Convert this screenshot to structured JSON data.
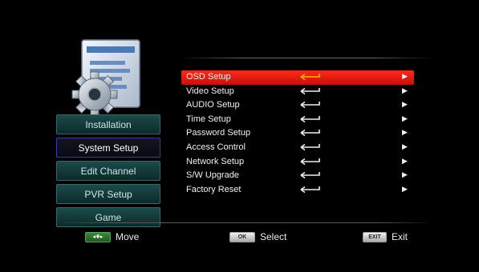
{
  "left_menu": {
    "items": [
      {
        "label": "Installation",
        "active": false
      },
      {
        "label": "System Setup",
        "active": true
      },
      {
        "label": "Edit Channel",
        "active": false
      },
      {
        "label": "PVR Setup",
        "active": false
      },
      {
        "label": "Game",
        "active": false
      }
    ]
  },
  "submenu": {
    "items": [
      {
        "label": "OSD Setup",
        "selected": true
      },
      {
        "label": "Video Setup",
        "selected": false
      },
      {
        "label": "AUDIO Setup",
        "selected": false
      },
      {
        "label": "Time Setup",
        "selected": false
      },
      {
        "label": "Password Setup",
        "selected": false
      },
      {
        "label": "Access Control",
        "selected": false
      },
      {
        "label": "Network Setup",
        "selected": false
      },
      {
        "label": "S/W Upgrade",
        "selected": false
      },
      {
        "label": "Factory Reset",
        "selected": false
      }
    ],
    "arrow_glyph": "▶"
  },
  "hints": {
    "move": {
      "key": "◂✚▸",
      "label": "Move"
    },
    "select": {
      "key": "OK",
      "label": "Select"
    },
    "exit": {
      "key": "EXIT",
      "label": "Exit"
    }
  },
  "icons": {
    "app": "settings-gear-document-icon",
    "enter": "enter-return-arrow-icon",
    "submenu_arrow": "chevron-right-icon"
  },
  "colors": {
    "background": "#000000",
    "selection": "#e8140f",
    "active_category_border": "#3a3ab0",
    "category_bg": "#1c4a4a",
    "nav_key": "#3a8a3a"
  }
}
